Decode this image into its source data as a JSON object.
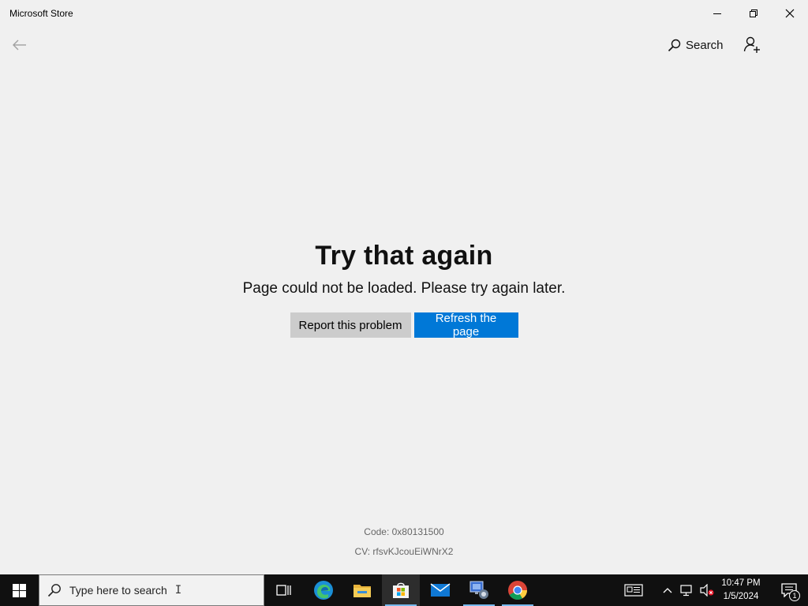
{
  "window": {
    "title": "Microsoft Store",
    "controls": {
      "minimize": "minimize-icon",
      "restore": "restore-icon",
      "close": "close-icon"
    }
  },
  "nav": {
    "back_icon": "back-arrow-icon",
    "search_label": "Search",
    "account_icon": "add-account-icon"
  },
  "error": {
    "title": "Try that again",
    "message": "Page could not be loaded. Please try again later.",
    "report_label": "Report this problem",
    "refresh_label": "Refresh the page",
    "code": "Code: 0x80131500",
    "cv": "CV: rfsvKJcouEiWNrX2"
  },
  "taskbar": {
    "search_placeholder": "Type here to search",
    "apps": [
      "task-view-icon",
      "edge-icon",
      "file-explorer-icon",
      "store-icon",
      "mail-icon",
      "network-app-icon",
      "chrome-icon"
    ],
    "active_app": "store-icon",
    "time": "10:47 PM",
    "date": "1/5/2024",
    "notification_count": "1"
  },
  "colors": {
    "accent": "#0078d7",
    "background": "#f0f0f0",
    "taskbar": "#101010",
    "secondary_button": "#cccccc"
  }
}
